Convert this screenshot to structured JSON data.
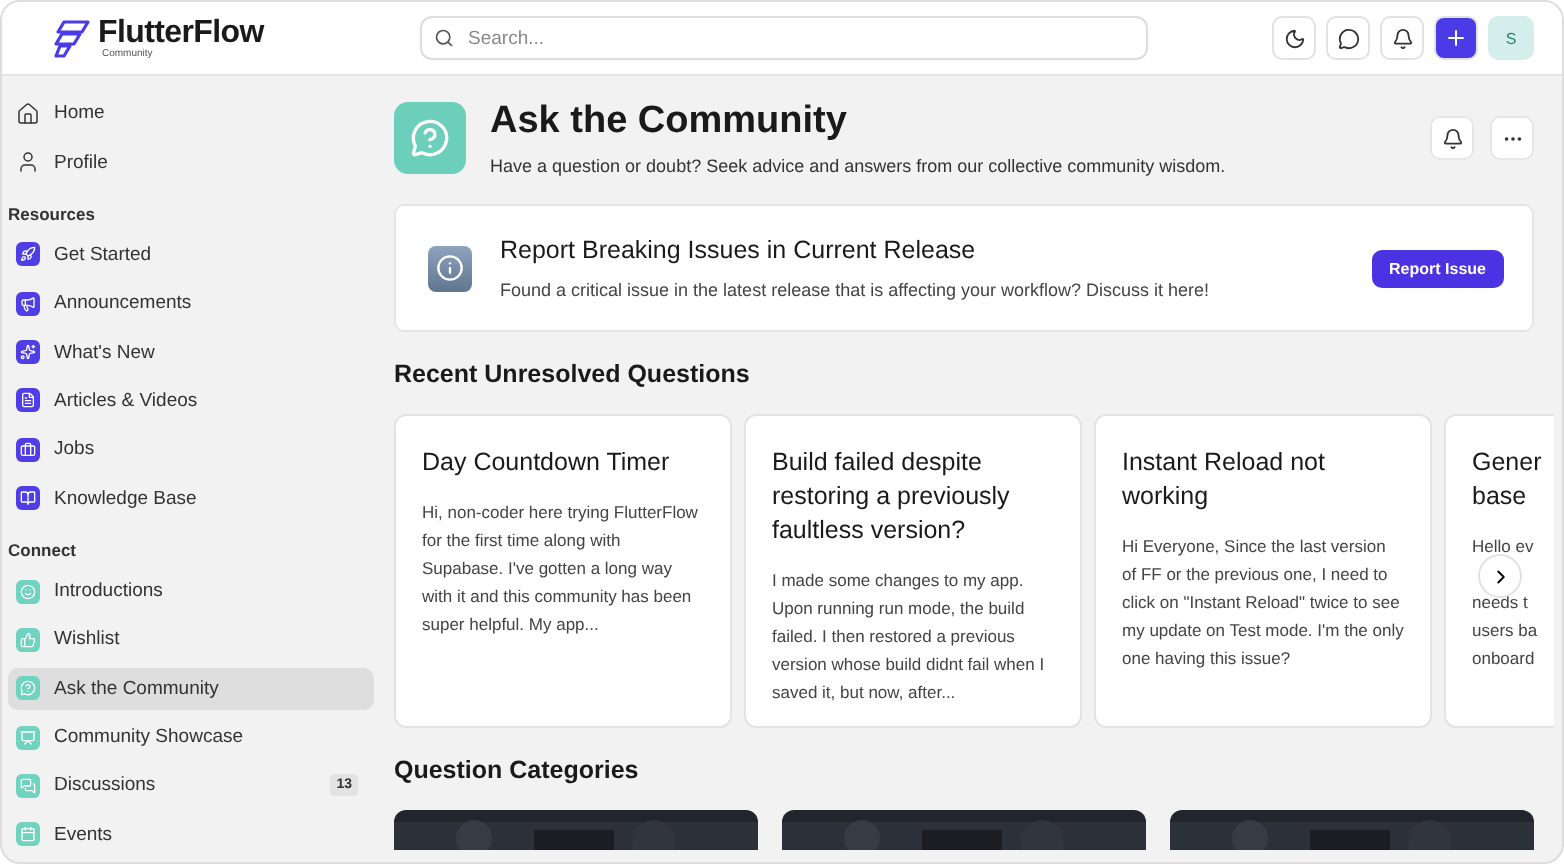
{
  "header": {
    "logo": {
      "name": "FlutterFlow",
      "tagline": "Community"
    },
    "search": {
      "placeholder": "Search..."
    },
    "avatar": "S"
  },
  "sidebar": {
    "top_items": [
      {
        "label": "Home",
        "selected": false
      },
      {
        "label": "Profile",
        "selected": false
      }
    ],
    "sections": [
      {
        "title": "Resources",
        "items": [
          {
            "label": "Get Started",
            "selected": false,
            "color": "#4f3ee6"
          },
          {
            "label": "Announcements",
            "selected": false,
            "color": "#4f3ee6"
          },
          {
            "label": "What's New",
            "selected": false,
            "color": "#4f3ee6"
          },
          {
            "label": "Articles & Videos",
            "selected": false,
            "color": "#4f3ee6"
          },
          {
            "label": "Jobs",
            "selected": false,
            "color": "#4f3ee6"
          },
          {
            "label": "Knowledge Base",
            "selected": false,
            "color": "#4f3ee6"
          }
        ]
      },
      {
        "title": "Connect",
        "items": [
          {
            "label": "Introductions",
            "selected": false,
            "color": "#6fd3bf"
          },
          {
            "label": "Wishlist",
            "selected": false,
            "color": "#6fd3bf"
          },
          {
            "label": "Ask the Community",
            "selected": true,
            "color": "#6fd3bf"
          },
          {
            "label": "Community Showcase",
            "selected": false,
            "color": "#6fd3bf"
          },
          {
            "label": "Discussions",
            "selected": false,
            "color": "#6fd3bf",
            "count": "13"
          },
          {
            "label": "Events",
            "selected": false,
            "color": "#6fd3bf"
          }
        ]
      }
    ]
  },
  "page": {
    "title": "Ask the Community",
    "subtitle": "Have a question or doubt? Seek advice and answers from our collective community wisdom."
  },
  "banner": {
    "title": "Report Breaking Issues in Current Release",
    "text": "Found a critical issue in the latest release that is affecting your workflow? Discuss it here!",
    "button": "Report Issue"
  },
  "recent": {
    "heading": "Recent Unresolved Questions",
    "cards": [
      {
        "title": "Day Countdown Timer",
        "excerpt": "Hi, non-coder here trying FlutterFlow for the first time along with Supabase. I've gotten a long way with it and this community has been super helpful. My app..."
      },
      {
        "title": "Build failed despite restoring a previously faultless version?",
        "excerpt": "I made some changes to my app. Upon running run mode, the build failed. I then restored a previous version whose build didnt fail when I saved it, but now, after..."
      },
      {
        "title": "Instant Reload not working",
        "excerpt": "Hi Everyone, Since the last version of FF or the previous one, I need to click on \"Instant Reload\" twice to see my update on Test mode. I'm the only one having this issue?"
      },
      {
        "title_lines": [
          "Gener",
          "base"
        ],
        "excerpt_lines": [
          "Hello ev",
          "needs t",
          "users ba",
          "onboard"
        ]
      }
    ]
  },
  "categories": {
    "heading": "Question Categories"
  }
}
